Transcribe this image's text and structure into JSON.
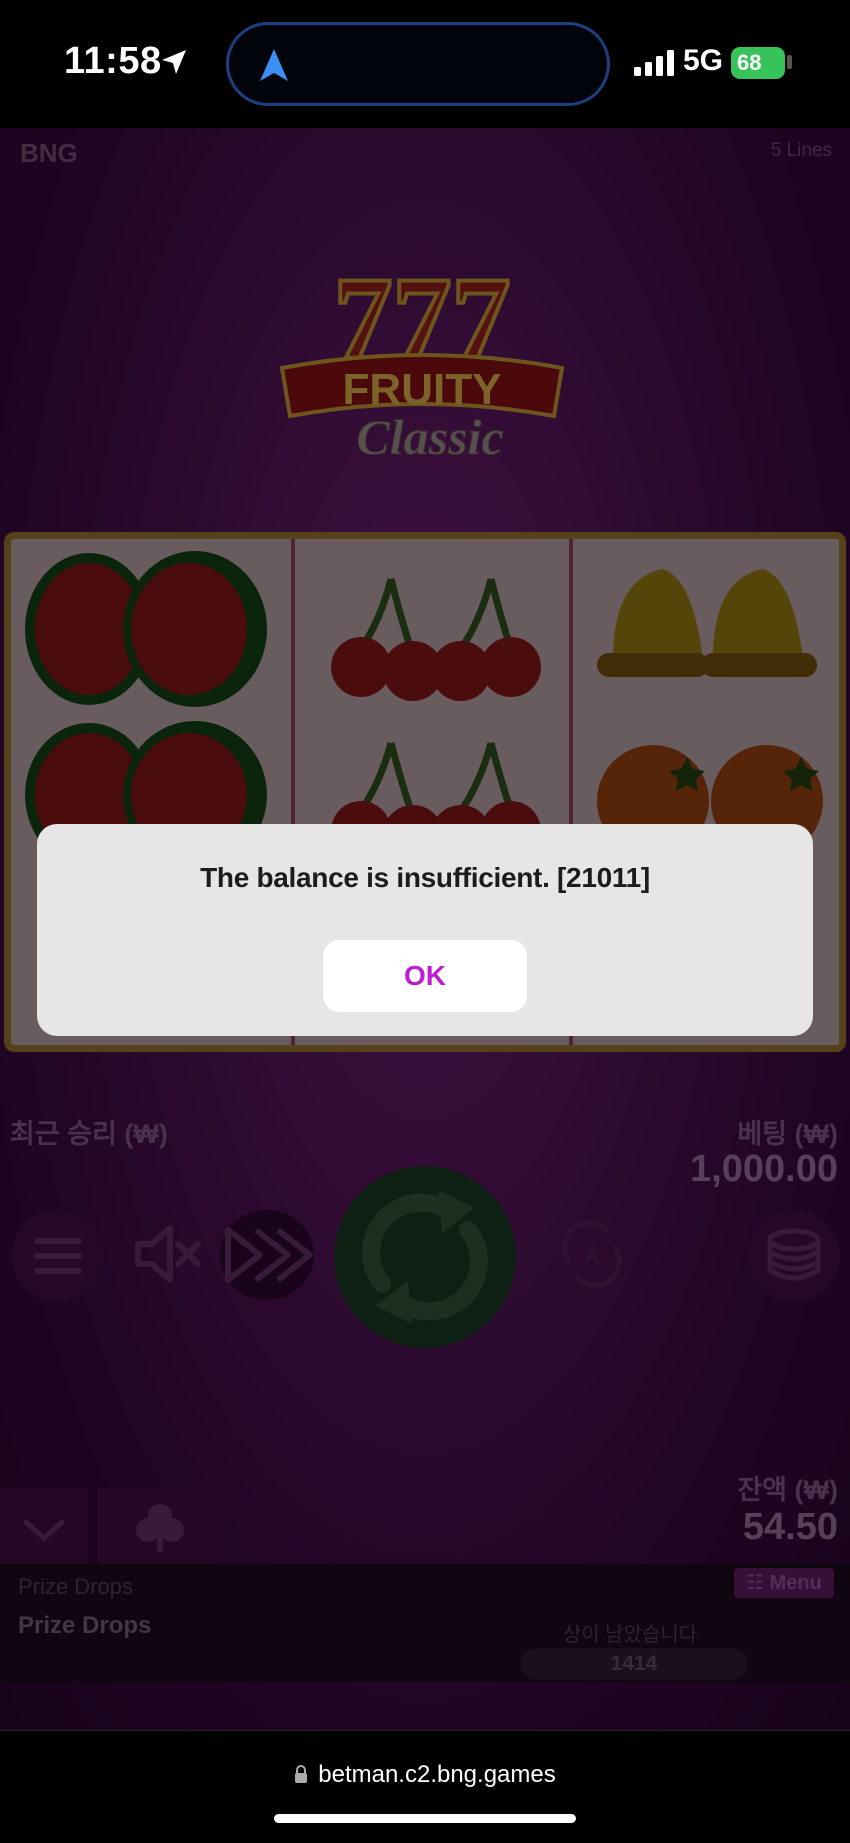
{
  "status_bar": {
    "time": "11:58",
    "network": "5G",
    "battery": "68"
  },
  "game": {
    "brand": "BNG",
    "lines": "5 Lines",
    "logo": {
      "line1": "777",
      "line2": "FRUITY",
      "line3": "Classic"
    },
    "reels": [
      [
        "watermelon",
        "watermelon",
        "watermelon",
        "watermelon"
      ],
      [
        "cherry",
        "cherry",
        "cherry",
        "cherry"
      ],
      [
        "bell",
        "bell",
        "orange",
        "orange"
      ]
    ],
    "last_win_label": "최근 승리 (₩)",
    "bet_label": "베팅 (₩)",
    "bet_value": "1,000.00",
    "balance_label": "잔액 (₩)",
    "balance_value": "54.50",
    "prize_drops": {
      "small_label": "Prize Drops",
      "title": "Prize Drops",
      "menu_label": "☷ Menu",
      "remaining_label": "상이 남았습니다",
      "remaining_count": "1414"
    }
  },
  "dialog": {
    "message": "The balance is insufficient. [21011]",
    "ok_label": "OK"
  },
  "browser": {
    "url": "betman.c2.bng.games"
  },
  "colors": {
    "dialog_ok_text": "#c21bd4",
    "battery_fill": "#37c25a",
    "spin_button": "#15341f"
  }
}
